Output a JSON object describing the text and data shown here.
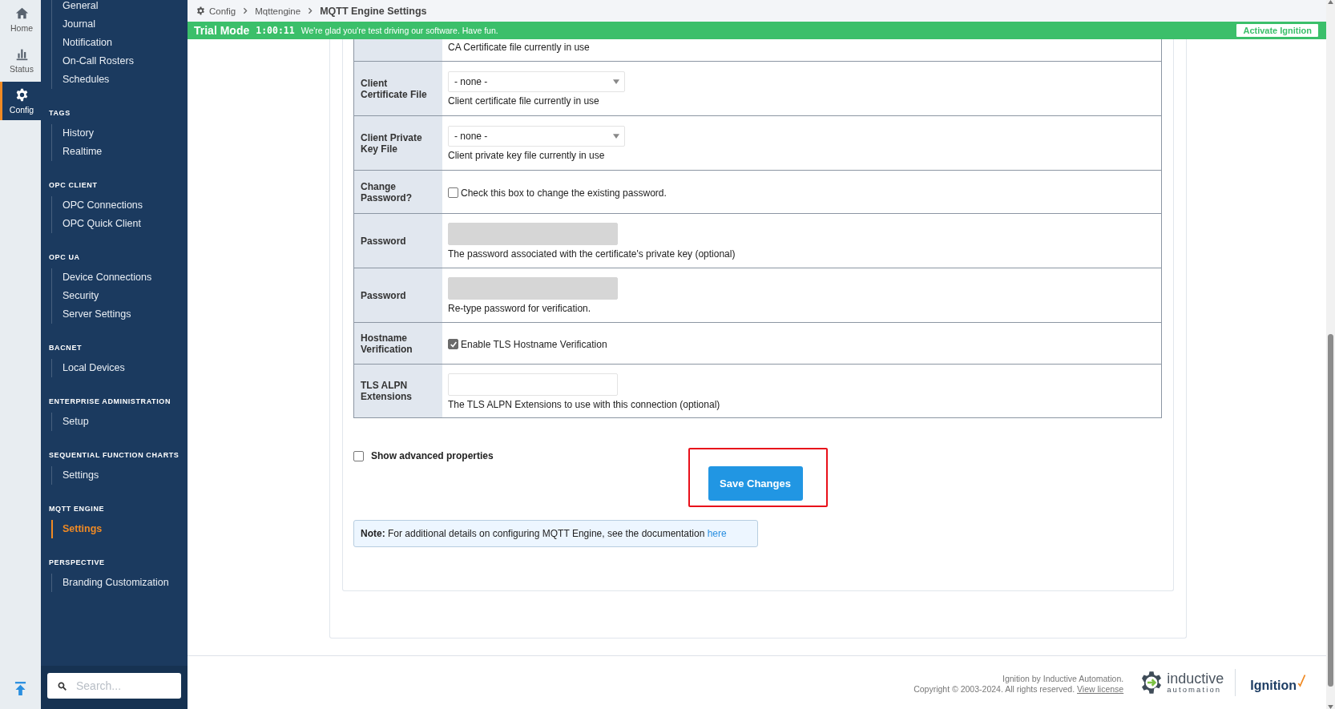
{
  "rail": {
    "items": [
      {
        "label": "Home",
        "selected": false
      },
      {
        "label": "Status",
        "selected": false
      },
      {
        "label": "Config",
        "selected": true
      }
    ]
  },
  "sidebar": {
    "sections": [
      {
        "items": [
          {
            "label": "General",
            "selected": false
          },
          {
            "label": "Journal",
            "selected": false
          },
          {
            "label": "Notification",
            "selected": false
          },
          {
            "label": "On-Call Rosters",
            "selected": false
          },
          {
            "label": "Schedules",
            "selected": false
          }
        ]
      },
      {
        "title": "TAGS",
        "items": [
          {
            "label": "History",
            "selected": false
          },
          {
            "label": "Realtime",
            "selected": false
          }
        ]
      },
      {
        "title": "OPC CLIENT",
        "items": [
          {
            "label": "OPC Connections",
            "selected": false
          },
          {
            "label": "OPC Quick Client",
            "selected": false
          }
        ]
      },
      {
        "title": "OPC UA",
        "items": [
          {
            "label": "Device Connections",
            "selected": false
          },
          {
            "label": "Security",
            "selected": false
          },
          {
            "label": "Server Settings",
            "selected": false
          }
        ]
      },
      {
        "title": "BACNET",
        "items": [
          {
            "label": "Local Devices",
            "selected": false
          }
        ]
      },
      {
        "title": "ENTERPRISE ADMINISTRATION",
        "items": [
          {
            "label": "Setup",
            "selected": false
          }
        ]
      },
      {
        "title": "SEQUENTIAL FUNCTION CHARTS",
        "items": [
          {
            "label": "Settings",
            "selected": false
          }
        ]
      },
      {
        "title": "MQTT ENGINE",
        "items": [
          {
            "label": "Settings",
            "selected": true
          }
        ]
      },
      {
        "title": "PERSPECTIVE",
        "items": [
          {
            "label": "Branding Customization",
            "selected": false
          }
        ]
      }
    ],
    "search": {
      "placeholder": "Search..."
    }
  },
  "breadcrumb": [
    {
      "label": "Config"
    },
    {
      "label": "Mqttengine"
    },
    {
      "label": "MQTT Engine Settings"
    }
  ],
  "trial_bar": {
    "title": "Trial Mode",
    "time": "1:00:11",
    "message": "We're glad you're test driving our software. Have fun.",
    "button": "Activate Ignition"
  },
  "form": {
    "rows": [
      {
        "kind": "description",
        "description": "CA Certificate file currently in use"
      },
      {
        "kind": "select",
        "label": "Client Certificate File",
        "value": "- none -",
        "description": "Client certificate file currently in use"
      },
      {
        "kind": "select",
        "label": "Client Private Key File",
        "value": "- none -",
        "description": "Client private key file currently in use"
      },
      {
        "kind": "checkbox",
        "label": "Change Password?",
        "checked": false,
        "text": "Check this box to change the existing password."
      },
      {
        "kind": "password",
        "label": "Password",
        "disabled": true,
        "description": "The password associated with the certificate's private key (optional)"
      },
      {
        "kind": "password",
        "label": "Password",
        "disabled": true,
        "description": "Re-type password for verification."
      },
      {
        "kind": "checkbox",
        "label": "Hostname Verification",
        "checked": true,
        "text": "Enable TLS Hostname Verification"
      },
      {
        "kind": "text",
        "label": "TLS ALPN Extensions",
        "disabled": false,
        "description": "The TLS ALPN Extensions to use with this connection (optional)"
      }
    ],
    "advanced": {
      "label": "Show advanced properties",
      "checked": false
    },
    "save_button": {
      "label": "Save Changes",
      "highlighted": true
    },
    "note": {
      "text": "**Note:** For additional details on configuring MQTT Engine, see the documentation",
      "link": "here"
    }
  },
  "footer": {
    "line1": "Ignition by Inductive Automation.",
    "line2": "Copyright © 2003-2024. All rights reserved.",
    "link": "View license",
    "company": "inductive",
    "company_sub": "automation",
    "product": "Ignition"
  }
}
